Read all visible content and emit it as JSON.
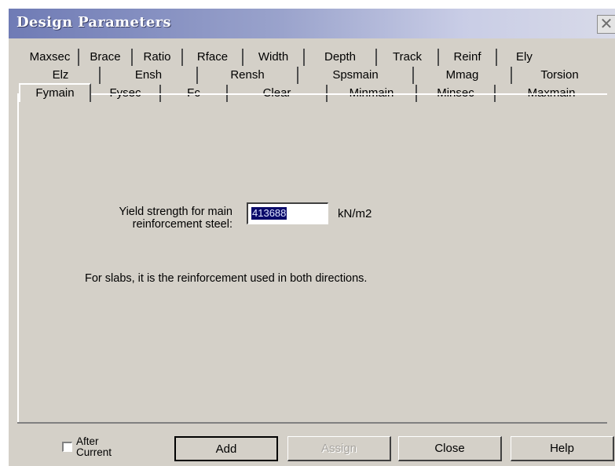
{
  "window": {
    "title": "Design Parameters",
    "close_glyph": "✕"
  },
  "tabs": {
    "row1": [
      "Maxsec",
      "Brace",
      "Ratio",
      "Rface",
      "Width",
      "Depth",
      "Track",
      "Reinf",
      "Ely"
    ],
    "row2": [
      "Elz",
      "Ensh",
      "Rensh",
      "Spsmain",
      "Mmag",
      "Torsion"
    ],
    "row3": [
      "Fymain",
      "Fysec",
      "Fc",
      "Clear",
      "Minmain",
      "Minsec",
      "Maxmain"
    ],
    "active": "Fymain"
  },
  "form": {
    "yield_label": "Yield strength for main reinforcement steel:",
    "yield_value": "413688",
    "unit": "kN/m2",
    "note": "For slabs, it is the reinforcement used in both directions."
  },
  "footer": {
    "checkbox_label": "After Current",
    "checkbox_checked": false,
    "add_label": "Add",
    "assign_label": "Assign",
    "close_label": "Close",
    "help_label": "Help"
  },
  "colors": {
    "dialog_bg": "#d4d0c8",
    "titlebar_start": "#6f7bb5",
    "selection": "#0a0a6a"
  }
}
